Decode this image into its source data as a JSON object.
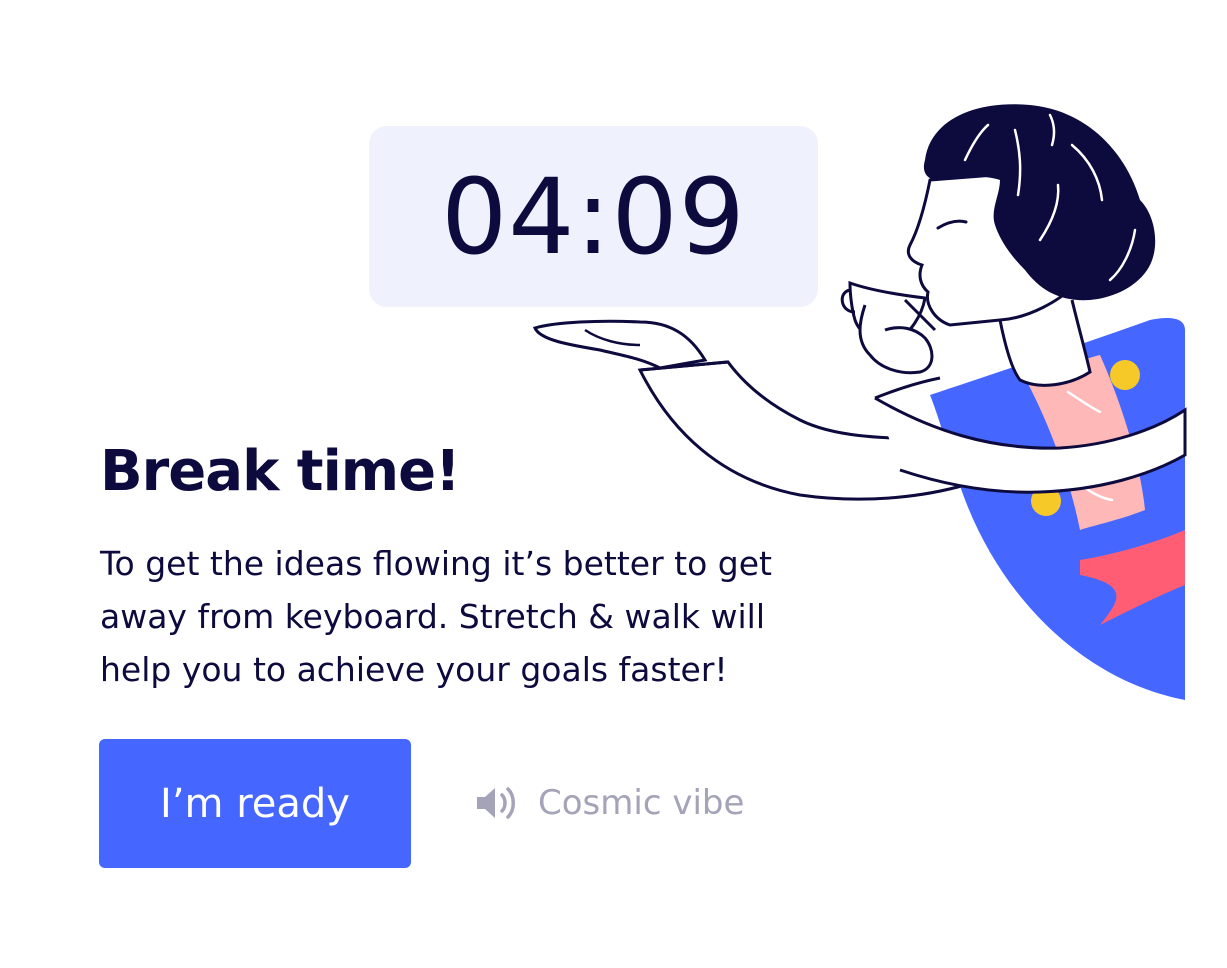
{
  "timer": {
    "display": "04:09"
  },
  "content": {
    "title": "Break time!",
    "description": "To get the ideas flowing it’s better to get away from keyboard. Stretch & walk will help you to achieve your goals faster!"
  },
  "actions": {
    "ready_label": "I’m ready",
    "sound_label": "Cosmic vibe",
    "sound_icon": "speaker-volume-icon"
  },
  "illustration": {
    "subject": "woman-drinking-coffee-illustration"
  },
  "colors": {
    "text_primary": "#0d0a3e",
    "accent": "#4567ff",
    "timer_background": "#eff2fd",
    "muted_text": "#a4a3b8",
    "dress_blue": "#4567ff",
    "dress_pink": "#ffb8b8",
    "dress_red": "#ff5d73",
    "dress_yellow": "#f6c928"
  }
}
